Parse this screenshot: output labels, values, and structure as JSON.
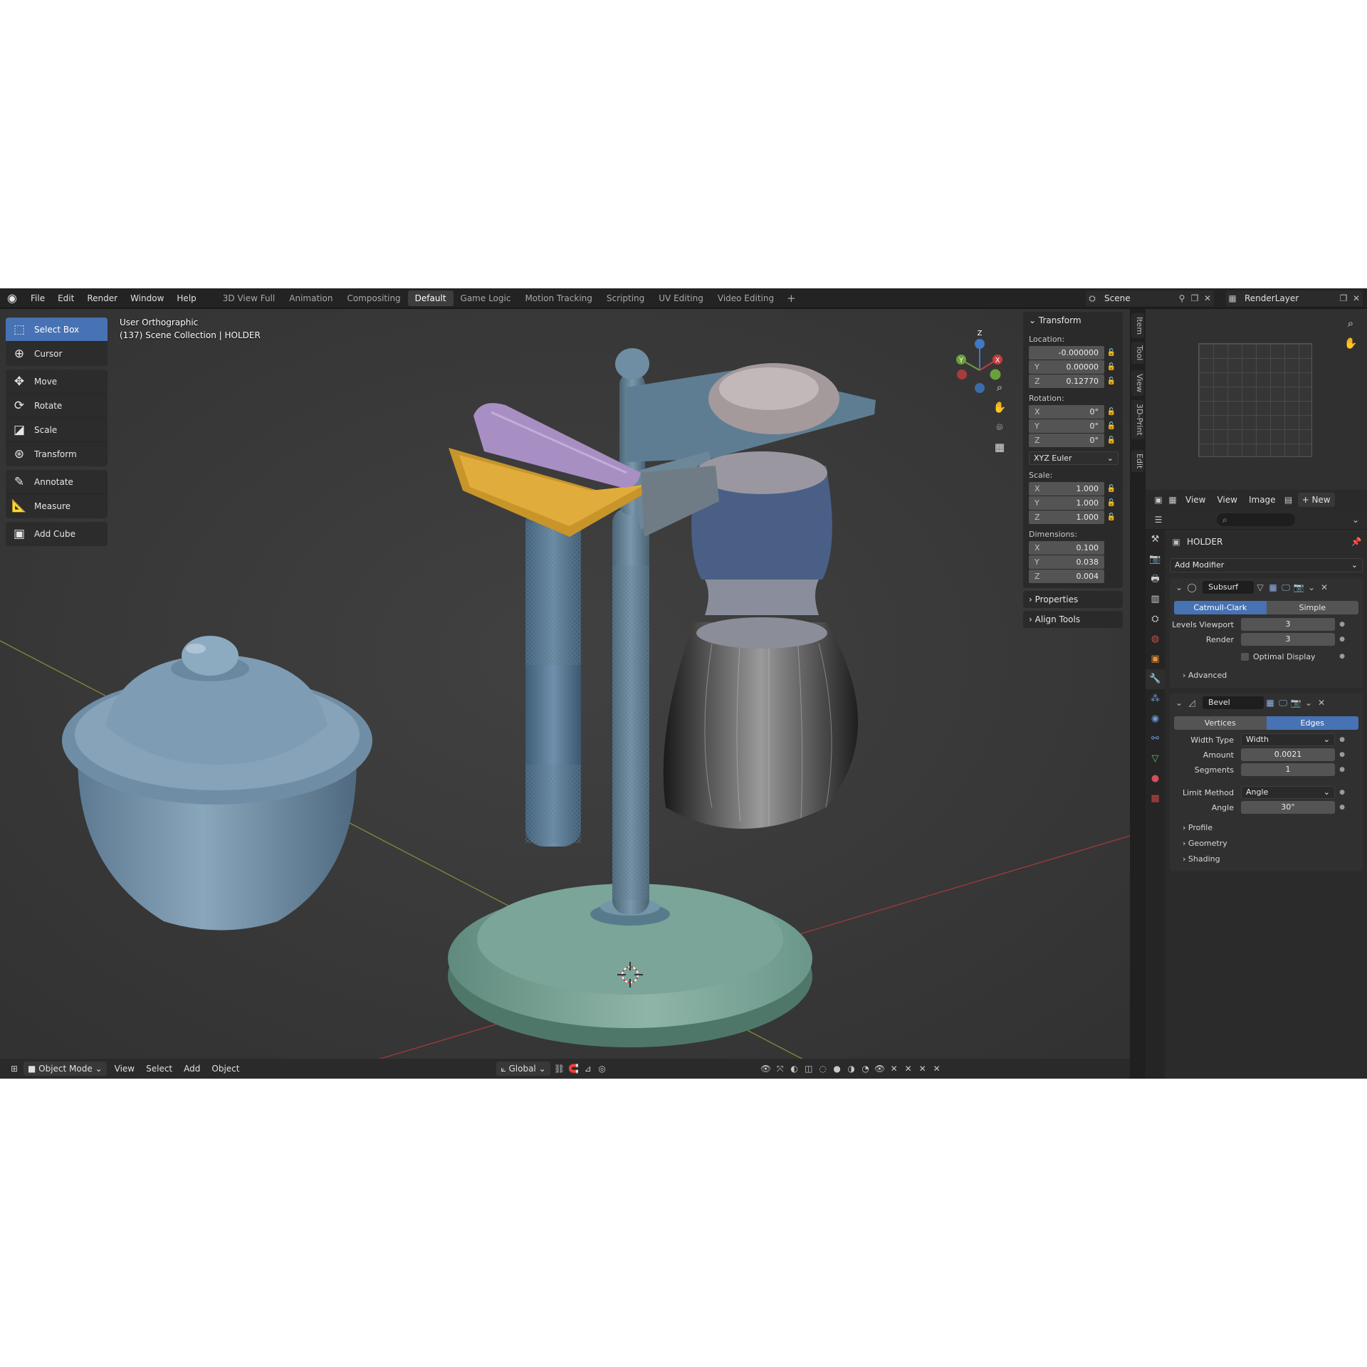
{
  "menu": [
    "File",
    "Edit",
    "Render",
    "Window",
    "Help"
  ],
  "workspaces": [
    "3D View Full",
    "Animation",
    "Compositing",
    "Default",
    "Game Logic",
    "Motion Tracking",
    "Scripting",
    "UV Editing",
    "Video Editing"
  ],
  "active_workspace": "Default",
  "scene": {
    "name": "Scene",
    "render_layer": "RenderLayer"
  },
  "viewport": {
    "view_name": "User Orthographic",
    "collection_info": "(137) Scene Collection | HOLDER"
  },
  "toolbar": [
    [
      "Select Box",
      "Cursor"
    ],
    [
      "Move",
      "Rotate",
      "Scale",
      "Transform"
    ],
    [
      "Annotate",
      "Measure"
    ],
    [
      "Add Cube"
    ]
  ],
  "gizmo_axes": {
    "x": "X",
    "y": "Y",
    "z": "Z"
  },
  "npanel": {
    "transform_title": "Transform",
    "location_label": "Location:",
    "location": [
      {
        "axis": "",
        "value": "-0.000000"
      },
      {
        "axis": "Y",
        "value": "0.00000"
      },
      {
        "axis": "Z",
        "value": "0.12770"
      }
    ],
    "rotation_label": "Rotation:",
    "rotation": [
      {
        "axis": "X",
        "value": "0°"
      },
      {
        "axis": "Y",
        "value": "0°"
      },
      {
        "axis": "Z",
        "value": "0°"
      }
    ],
    "rotation_mode": "XYZ Euler",
    "scale_label": "Scale:",
    "scale": [
      {
        "axis": "X",
        "value": "1.000"
      },
      {
        "axis": "Y",
        "value": "1.000"
      },
      {
        "axis": "Z",
        "value": "1.000"
      }
    ],
    "dimensions_label": "Dimensions:",
    "dimensions": [
      {
        "axis": "X",
        "value": "0.100"
      },
      {
        "axis": "Y",
        "value": "0.038"
      },
      {
        "axis": "Z",
        "value": "0.004"
      }
    ],
    "properties_label": "Properties",
    "align_tools_label": "Align Tools"
  },
  "side_tabs": [
    "Item",
    "Tool",
    "View",
    "3D-Print",
    "Edit"
  ],
  "viewport_header": {
    "mode": "Object Mode",
    "menus": [
      "View",
      "Select",
      "Add",
      "Object"
    ],
    "orientation": "Global"
  },
  "image_editor": {
    "menus": [
      "View",
      "View",
      "Image"
    ],
    "new_label": "New"
  },
  "properties": {
    "object_name": "HOLDER",
    "add_modifier": "Add Modifier",
    "subsurf": {
      "name": "Subsurf",
      "mode_options": [
        "Catmull-Clark",
        "Simple"
      ],
      "mode_selected": "Catmull-Clark",
      "levels_viewport_label": "Levels Viewport",
      "levels_viewport": "3",
      "render_label": "Render",
      "render": "3",
      "optimal_display": "Optimal Display",
      "advanced": "Advanced"
    },
    "bevel": {
      "name": "Bevel",
      "affect_options": [
        "Vertices",
        "Edges"
      ],
      "affect_selected": "Edges",
      "width_type_label": "Width Type",
      "width_type": "Width",
      "amount_label": "Amount",
      "amount": "0.0021",
      "segments_label": "Segments",
      "segments": "1",
      "limit_method_label": "Limit Method",
      "limit_method": "Angle",
      "angle_label": "Angle",
      "angle": "30°",
      "subpanels": [
        "Profile",
        "Geometry",
        "Shading"
      ]
    }
  },
  "colors": {
    "accent": "#4772b3",
    "viewport_bg": "#393939",
    "panel_bg": "#2b2b2b"
  }
}
